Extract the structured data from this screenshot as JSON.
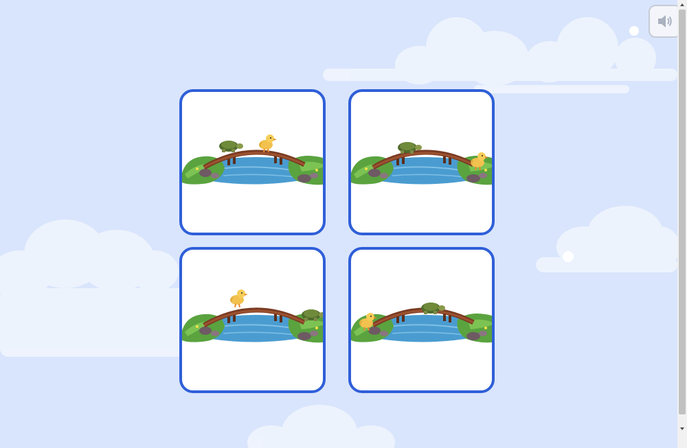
{
  "background_color": "#d9e5fc",
  "accent_color": "#2f5fd8",
  "speaker_button": {
    "icon": "speaker-icon",
    "state": "muted-style"
  },
  "cards": [
    {
      "id": "card-1",
      "scene": "turtle-middle-duck-right-on-bridge"
    },
    {
      "id": "card-2",
      "scene": "turtle-on-bridge-duck-right-bank"
    },
    {
      "id": "card-3",
      "scene": "duck-on-bridge-turtle-right-bank"
    },
    {
      "id": "card-4",
      "scene": "duck-left-bank-turtle-on-bridge"
    }
  ]
}
